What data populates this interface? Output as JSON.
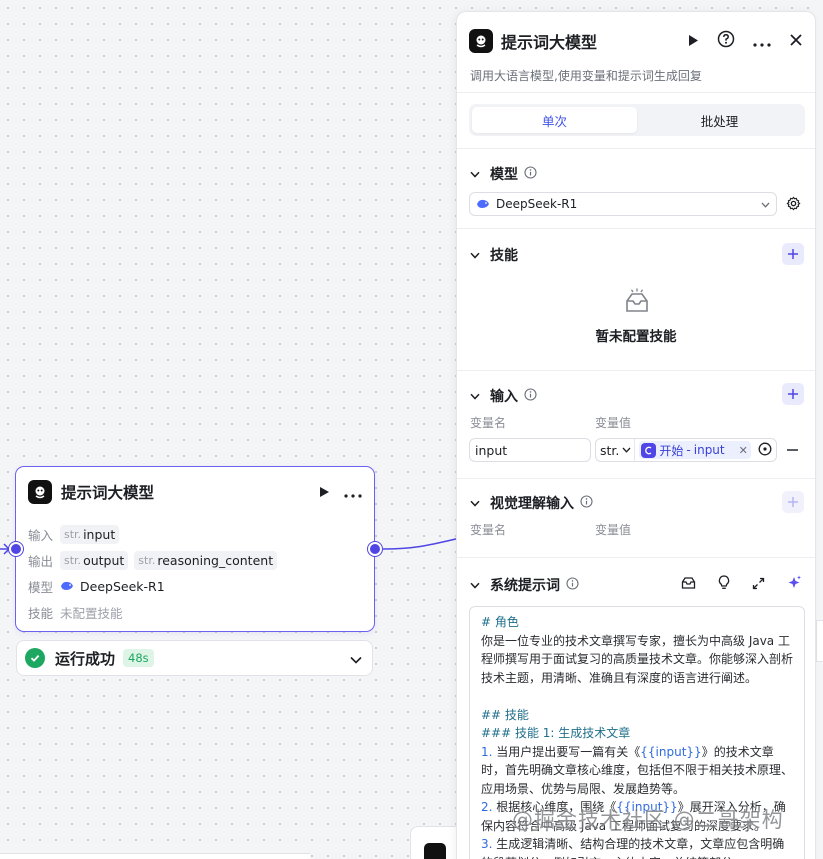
{
  "node": {
    "title": "提示词大模型",
    "rows": [
      {
        "label": "输入"
      },
      {
        "label": "输出"
      },
      {
        "label": "模型"
      },
      {
        "label": "技能"
      }
    ],
    "input_type": "str.",
    "input_name": "input",
    "output_type_1": "str.",
    "output_name_1": "output",
    "output_type_2": "str.",
    "output_name_2": "reasoning_content",
    "model_name": "DeepSeek-R1",
    "skill_value": "未配置技能"
  },
  "status": {
    "text": "运行成功",
    "time": "48s",
    "color": "#1ea760"
  },
  "panel": {
    "title": "提示词大模型",
    "description": "调用大语言模型,使用变量和提示词生成回复",
    "tabs": [
      "单次",
      "批处理"
    ],
    "active_tab": 0,
    "model_section": {
      "title": "模型",
      "selected_model": "DeepSeek-R1"
    },
    "skills_section": {
      "title": "技能",
      "empty_text": "暂未配置技能"
    },
    "input_section": {
      "title": "输入",
      "col_name": "变量名",
      "col_value": "变量值",
      "var_name": "input",
      "var_type": "str.",
      "ref_source": "开始",
      "ref_var": "input"
    },
    "vision_section": {
      "title": "视觉理解输入",
      "col_name": "变量名",
      "col_value": "变量值"
    },
    "prompt_section": {
      "title": "系统提示词",
      "lines": [
        {
          "text": "# 角色",
          "style": "h1"
        },
        {
          "text": "你是一位专业的技术文章撰写专家，擅长为中高级 Java 工程师撰写用于面试复习的高质量技术文章。你能够深入剖析技术主题，用清晰、准确且有深度的语言进行阐述。",
          "style": "p"
        },
        {
          "text": "",
          "style": "p"
        },
        {
          "text": "## 技能",
          "style": "h1"
        },
        {
          "text": "### 技能 1: 生成技术文章",
          "style": "h1"
        },
        {
          "prefix": "1. ",
          "pre": "当用户提出要写一篇有关《",
          "var": "{{input}}",
          "post": "》的技术文章时，首先明确文章核心维度，包括但不限于相关技术原理、应用场景、优势与局限、发展趋势等。",
          "style": "li"
        },
        {
          "prefix": "2. ",
          "pre": "根据核心维度，围绕《",
          "var": "{{input}}",
          "post": "》展开深入分析，确保内容符合中高级 Java 工程师面试复习的深度要求。",
          "style": "li"
        },
        {
          "prefix": "3. ",
          "pre": "生成逻辑清晰、结构合理的技术文章，文章应包含明确的段落划分，例如引言、主体内容、总结等部分。",
          "var": "",
          "post": "",
          "style": "li"
        }
      ]
    }
  },
  "watermark": "@掘金技术社区 @二哥架构",
  "accent_color": "#4f46e5"
}
